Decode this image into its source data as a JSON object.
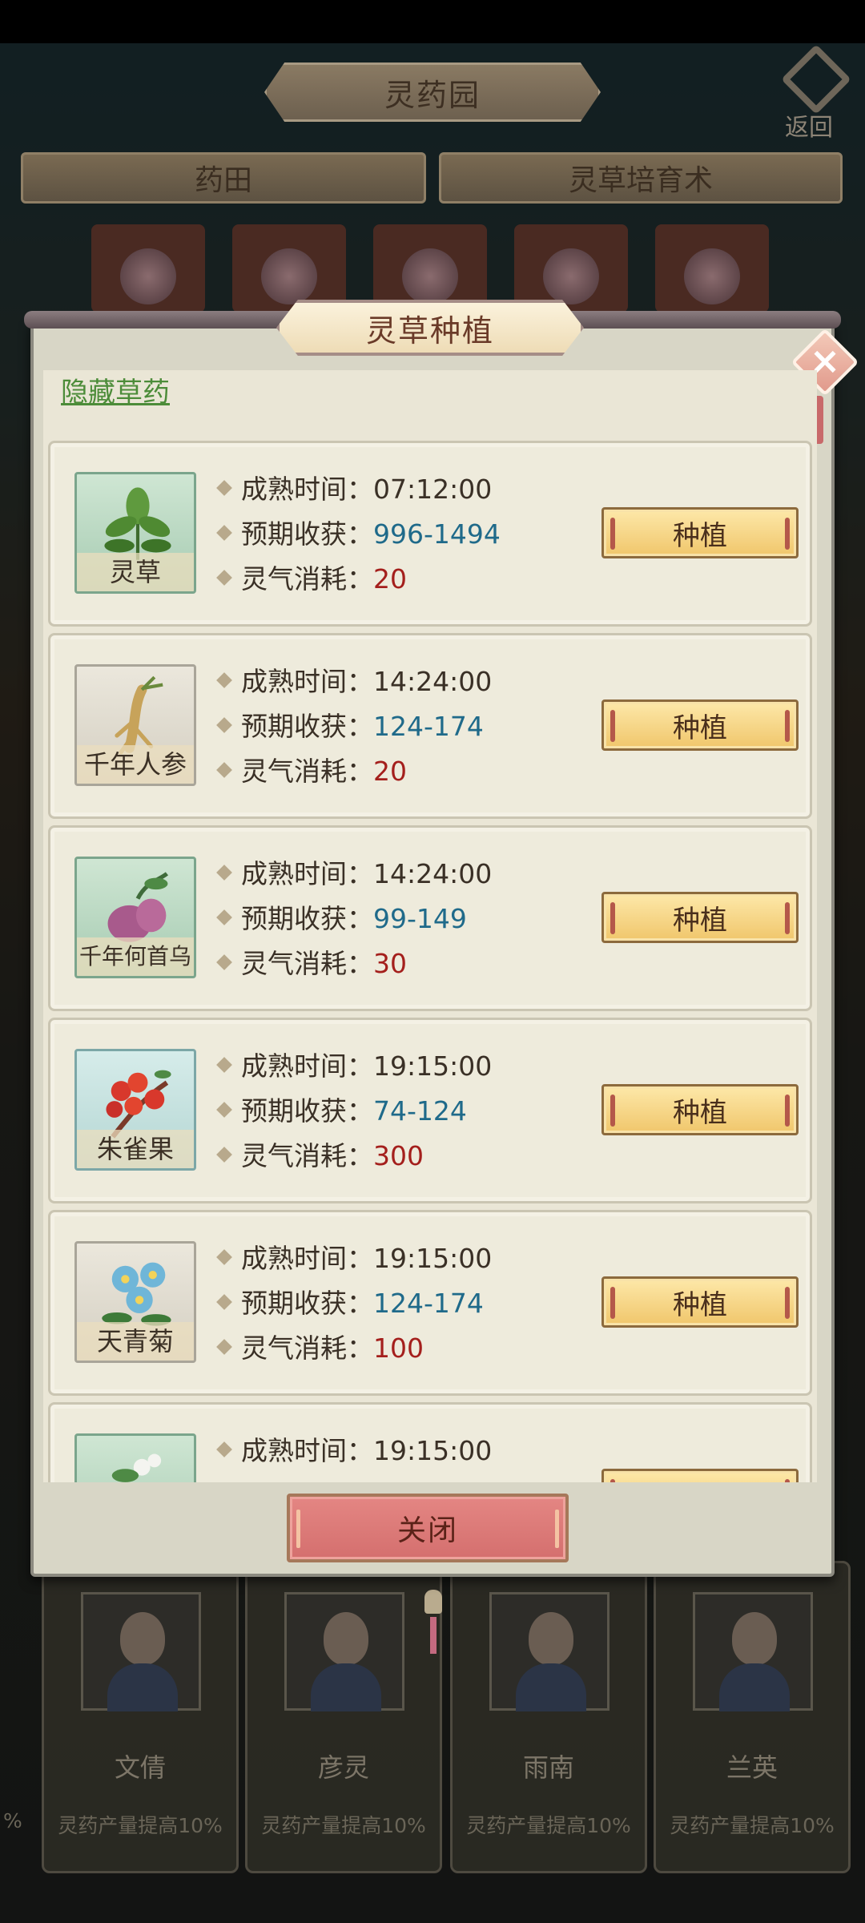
{
  "header": {
    "title": "灵药园",
    "back_label": "返回"
  },
  "top_tabs": [
    {
      "label": "药田"
    },
    {
      "label": "灵草培育术"
    }
  ],
  "dialog": {
    "title": "灵草种植",
    "hide_link": "隐藏草药",
    "close_button": "关闭",
    "close_icon": "×",
    "stat_labels": {
      "time": "成熟时间：",
      "yield": "预期收获：",
      "cost": "灵气消耗："
    },
    "plant_label": "种植",
    "items": [
      {
        "name": "灵草",
        "icon": "spirit-grass-icon",
        "time": "07:12:00",
        "yield": "996-1494",
        "cost": "20"
      },
      {
        "name": "千年人参",
        "icon": "ginseng-icon",
        "time": "14:24:00",
        "yield": "124-174",
        "cost": "20"
      },
      {
        "name": "千年何首乌",
        "icon": "fo-ti-root-icon",
        "time": "14:24:00",
        "yield": "99-149",
        "cost": "30"
      },
      {
        "name": "朱雀果",
        "icon": "vermilion-fruit-icon",
        "time": "19:15:00",
        "yield": "74-124",
        "cost": "300"
      },
      {
        "name": "天青菊",
        "icon": "azure-chrysanthemum-icon",
        "time": "19:15:00",
        "yield": "124-174",
        "cost": "100"
      },
      {
        "name": "",
        "icon": "white-flower-icon",
        "time": "19:15:00",
        "yield": "",
        "cost": ""
      }
    ]
  },
  "maids": [
    {
      "name": "文倩",
      "bonus": "灵药产量提高10%"
    },
    {
      "name": "彦灵",
      "bonus": "灵药产量提高10%"
    },
    {
      "name": "雨南",
      "bonus": "灵药产量提高10%"
    },
    {
      "name": "兰英",
      "bonus": "灵药产量提高10%"
    }
  ],
  "edge_fragment": "%",
  "colors": {
    "yield": "#1f6a8a",
    "cost": "#a41f1c",
    "link": "#4c8c39",
    "plant_button": "#f0c66b",
    "close_button": "#d46f6e"
  }
}
